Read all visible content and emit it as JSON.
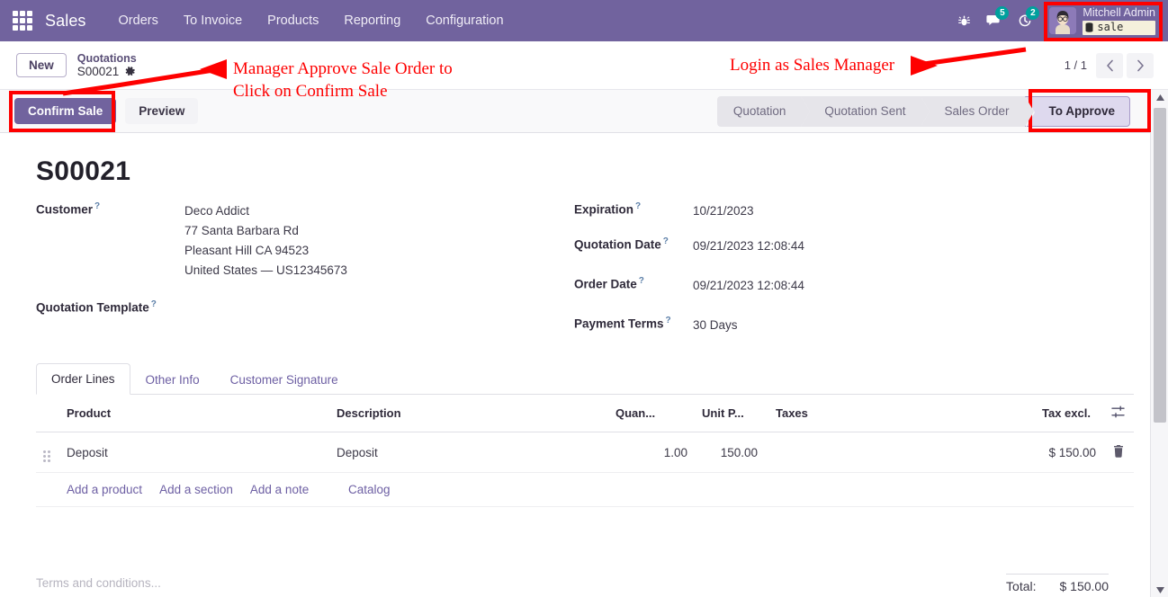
{
  "navbar": {
    "apps_icon": "apps-grid-icon",
    "brand": "Sales",
    "menu": [
      {
        "label": "Orders"
      },
      {
        "label": "To Invoice"
      },
      {
        "label": "Products"
      },
      {
        "label": "Reporting"
      },
      {
        "label": "Configuration"
      }
    ],
    "icons": [
      {
        "name": "bug-icon",
        "glyph": "⚙",
        "badge": ""
      },
      {
        "name": "messages-icon",
        "glyph": "ὊC",
        "badge": "5"
      },
      {
        "name": "activities-clock-icon",
        "glyph": "◴",
        "badge": "2"
      }
    ],
    "user": {
      "name": "Mitchell Admin",
      "database": "sale",
      "db_icon": "database-icon",
      "avatar": "user-avatar"
    }
  },
  "control_panel": {
    "new_label": "New",
    "breadcrumb_parent": "Quotations",
    "breadcrumb_current": "S00021",
    "gear_icon": "gear-icon",
    "pager_count": "1 / 1",
    "prev_icon": "chevron-left-icon",
    "next_icon": "chevron-right-icon"
  },
  "action_bar": {
    "confirm_label": "Confirm Sale",
    "preview_label": "Preview",
    "statuses": [
      {
        "label": "Quotation",
        "active": false
      },
      {
        "label": "Quotation Sent",
        "active": false
      },
      {
        "label": "Sales Order",
        "active": false
      },
      {
        "label": "To Approve",
        "active": true
      }
    ]
  },
  "record": {
    "title": "S00021",
    "left_fields": [
      {
        "label": "Customer",
        "help": "?",
        "lines": [
          "Deco Addict",
          "77 Santa Barbara Rd",
          "Pleasant Hill CA 94523",
          "United States — US12345673"
        ]
      },
      {
        "label": "Quotation Template",
        "help": "?",
        "lines": []
      }
    ],
    "right_fields": [
      {
        "label": "Expiration",
        "help": "?",
        "value": "10/21/2023"
      },
      {
        "label": "Quotation Date",
        "help": "?",
        "value": "09/21/2023 12:08:44"
      },
      {
        "label": "Order Date",
        "help": "?",
        "value": "09/21/2023 12:08:44"
      },
      {
        "label": "Payment Terms",
        "help": "?",
        "value": "30 Days"
      }
    ]
  },
  "notebook": {
    "tabs": [
      {
        "label": "Order Lines",
        "selected": true
      },
      {
        "label": "Other Info",
        "selected": false
      },
      {
        "label": "Customer Signature",
        "selected": false
      }
    ]
  },
  "order_lines": {
    "columns": [
      "Product",
      "Description",
      "Quan...",
      "Unit P...",
      "Taxes",
      "Tax excl."
    ],
    "optional_columns_icon": "column-settings-icon",
    "rows": [
      {
        "drag_handle": "drag-handle-icon",
        "product": "Deposit",
        "description": "Deposit",
        "quantity": "1.00",
        "unit_price": "150.00",
        "taxes": "",
        "tax_excl": "$ 150.00",
        "delete_icon": "trash-icon"
      }
    ],
    "add_links": [
      {
        "label": "Add a product"
      },
      {
        "label": "Add a section"
      },
      {
        "label": "Add a note"
      },
      {
        "label": "Catalog"
      }
    ]
  },
  "footer": {
    "terms_placeholder": "Terms and conditions...",
    "total_label": "Total:",
    "total_value": "$ 150.00",
    "collapse_icon": "chevron-down-icon"
  },
  "annotations": [
    {
      "text_line1": "Manager Approve Sale Order to",
      "text_line2": "Click on Confirm Sale"
    },
    {
      "text_line1": "Login as Sales Manager",
      "text_line2": ""
    }
  ],
  "colors": {
    "brand_purple": "#71639e",
    "annotation_red": "#fe0000",
    "badge_teal": "#00a09d",
    "status_active_bg": "#ded9ee"
  }
}
